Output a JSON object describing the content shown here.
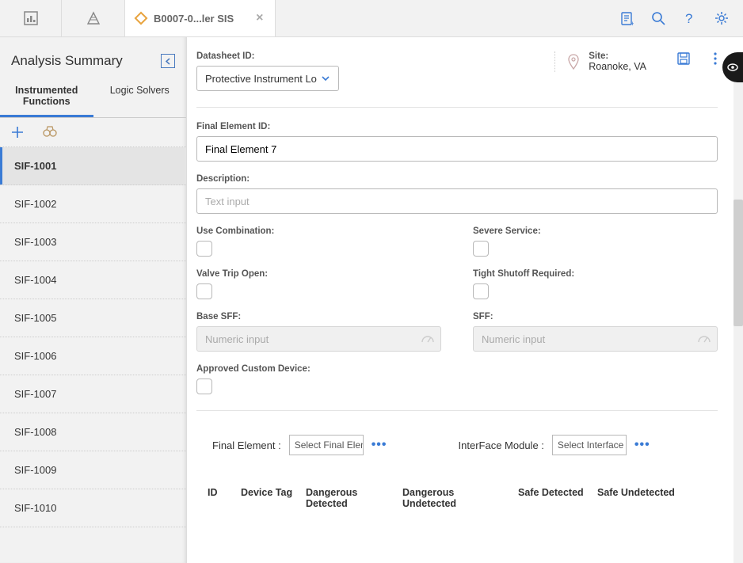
{
  "top": {
    "tab_label": "B0007-0...ler SIS"
  },
  "sidebar": {
    "title": "Analysis Summary",
    "tabs": {
      "instrumented": "Instrumented Functions",
      "logic": "Logic Solvers"
    },
    "items": [
      "SIF-1001",
      "SIF-1002",
      "SIF-1003",
      "SIF-1004",
      "SIF-1005",
      "SIF-1006",
      "SIF-1007",
      "SIF-1008",
      "SIF-1009",
      "SIF-1010"
    ]
  },
  "form": {
    "datasheet_label": "Datasheet ID:",
    "datasheet_value": "Protective Instrument Lo",
    "site_label": "Site:",
    "site_value": "Roanoke, VA",
    "final_element_id_label": "Final Element ID:",
    "final_element_id_value": "Final Element 7",
    "description_label": "Description:",
    "description_placeholder": "Text input",
    "use_combination_label": "Use Combination:",
    "severe_service_label": "Severe Service:",
    "valve_trip_label": "Valve Trip Open:",
    "tight_shutoff_label": "Tight Shutoff Required:",
    "base_sff_label": "Base SFF:",
    "sff_label": "SFF:",
    "numeric_placeholder": "Numeric input",
    "approved_custom_label": "Approved Custom Device:"
  },
  "lower": {
    "final_element_label": "Final Element :",
    "final_element_placeholder": "Select Final Elem",
    "interface_label": "InterFace Module :",
    "interface_placeholder": "Select Interface "
  },
  "table": {
    "h_id": "ID",
    "h_device_tag": "Device Tag",
    "h_dd": "Dangerous Detected",
    "h_du": "Dangerous Undetected",
    "h_sd": "Safe Detected",
    "h_su": "Safe Undetected"
  }
}
